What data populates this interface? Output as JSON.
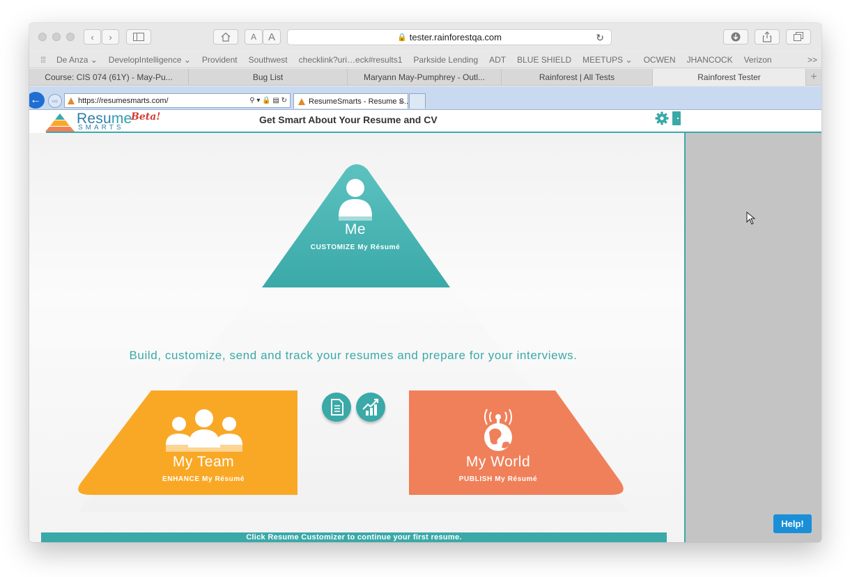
{
  "safari": {
    "address": "tester.rainforestqa.com",
    "bookmarks": [
      "De Anza ⌄",
      "DevelopIntelligence ⌄",
      "Provident",
      "Southwest",
      "checklink?uri…eck#results1",
      "Parkside Lending",
      "ADT",
      "BLUE SHIELD",
      "MEETUPS ⌄",
      "OCWEN",
      "JHANCOCK",
      "Verizon"
    ],
    "bookmarks_more": ">>",
    "tabs": [
      "Course: CIS 074 (61Y) - May-Pu...",
      "Bug List",
      "Maryann May-Pumphrey - Outl...",
      "Rainforest | All Tests",
      "Rainforest Tester"
    ],
    "new_tab": "+"
  },
  "ie": {
    "url": "https://resumesmarts.com/",
    "tab_title": "ResumeSmarts - Resume S...",
    "tab_close": "×"
  },
  "site": {
    "logo_main": "Resu",
    "logo_me": "me",
    "logo_sub": "SMARTS",
    "beta": "Beta!",
    "tagline": "Get Smart About Your Resume and CV",
    "headline": "Build, customize, send and track your resumes and prepare for your interviews.",
    "me": {
      "title": "Me",
      "sub": "CUSTOMIZE My Résumé"
    },
    "team": {
      "title": "My Team",
      "sub": "ENHANCE My Résumé"
    },
    "world": {
      "title": "My World",
      "sub": "PUBLISH My Résumé"
    },
    "footer": "Click Resume Customizer to continue your first resume.",
    "help": "Help!"
  },
  "colors": {
    "teal": "#3aa9a8",
    "orange": "#f9a826",
    "coral": "#f0805a",
    "panel": "#c4c4c4"
  }
}
